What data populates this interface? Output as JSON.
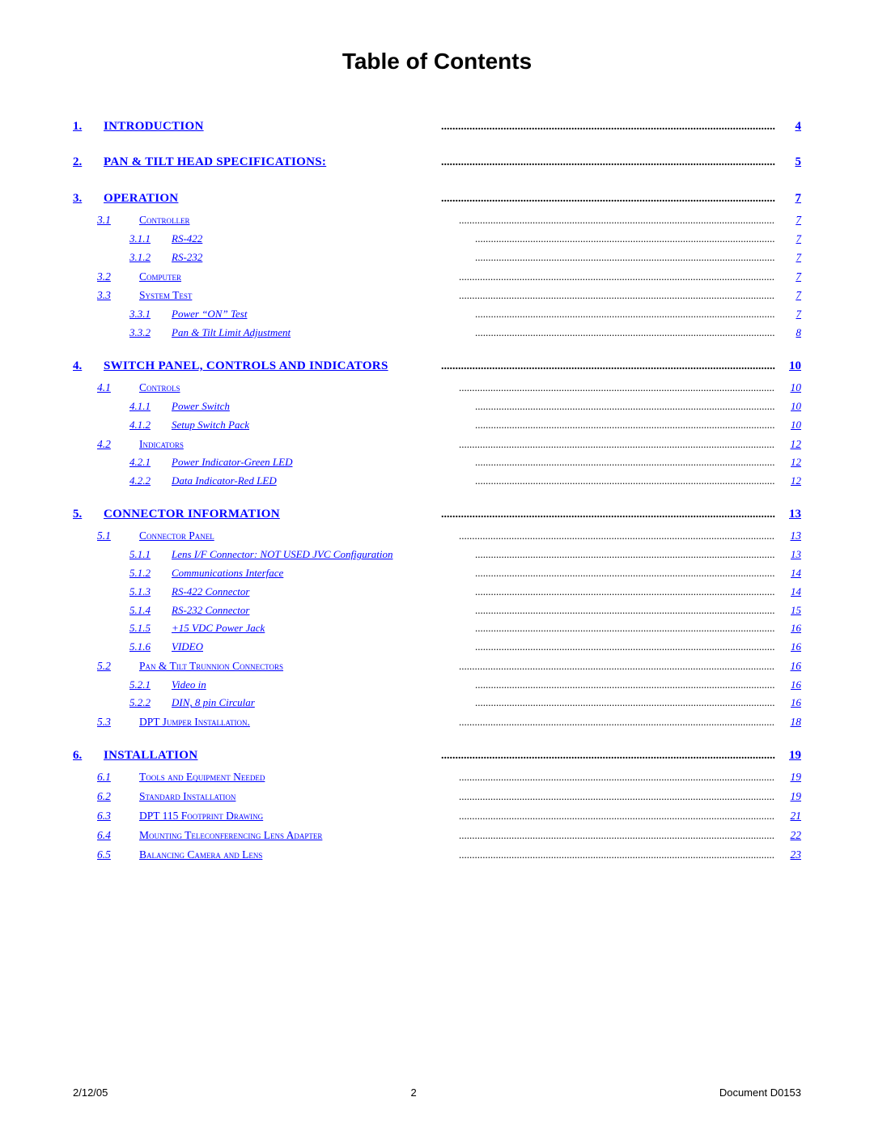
{
  "title": "Table of Contents",
  "sections": [
    {
      "num": "1.",
      "label": "INTRODUCTION",
      "page": "4",
      "level": "main",
      "children": []
    },
    {
      "num": "2.",
      "label": "PAN & TILT HEAD SPECIFICATIONS:",
      "page": "5",
      "level": "main",
      "children": []
    },
    {
      "num": "3.",
      "label": "OPERATION",
      "page": "7",
      "level": "main",
      "children": [
        {
          "num": "3.1",
          "label": "Controller",
          "page": "7",
          "level": "sub1",
          "children": [
            {
              "num": "3.1.1",
              "label": "RS-422",
              "page": "7",
              "level": "sub2"
            },
            {
              "num": "3.1.2",
              "label": "RS-232",
              "page": "7",
              "level": "sub2"
            }
          ]
        },
        {
          "num": "3.2",
          "label": "Computer",
          "page": "7",
          "level": "sub1",
          "children": []
        },
        {
          "num": "3.3",
          "label": "System Test",
          "page": "7",
          "level": "sub1",
          "children": [
            {
              "num": "3.3.1",
              "label": "Power “ON” Test",
              "page": "7",
              "level": "sub2"
            },
            {
              "num": "3.3.2",
              "label": "Pan & Tilt Limit Adjustment",
              "page": "8",
              "level": "sub2"
            }
          ]
        }
      ]
    },
    {
      "num": "4.",
      "label": "SWITCH PANEL, CONTROLS AND INDICATORS",
      "page": "10",
      "level": "main",
      "children": [
        {
          "num": "4.1",
          "label": "Controls",
          "page": "10",
          "level": "sub1",
          "children": [
            {
              "num": "4.1.1",
              "label": "Power Switch",
              "page": "10",
              "level": "sub2"
            },
            {
              "num": "4.1.2",
              "label": "Setup Switch Pack",
              "page": "10",
              "level": "sub2"
            }
          ]
        },
        {
          "num": "4.2",
          "label": "Indicators",
          "page": "12",
          "level": "sub1",
          "children": [
            {
              "num": "4.2.1",
              "label": "Power Indicator-Green LED",
              "page": "12",
              "level": "sub2"
            },
            {
              "num": "4.2.2",
              "label": "Data Indicator-Red LED",
              "page": "12",
              "level": "sub2"
            }
          ]
        }
      ]
    },
    {
      "num": "5.",
      "label": "CONNECTOR INFORMATION",
      "page": "13",
      "level": "main",
      "children": [
        {
          "num": "5.1",
          "label": "Connector Panel",
          "page": "13",
          "level": "sub1",
          "children": [
            {
              "num": "5.1.1",
              "label": "Lens I/F Connector: NOT USED JVC Configuration",
              "page": "13",
              "level": "sub2"
            },
            {
              "num": "5.1.2",
              "label": "Communications Interface",
              "page": "14",
              "level": "sub2"
            },
            {
              "num": "5.1.3",
              "label": "RS-422 Connector",
              "page": "14",
              "level": "sub2"
            },
            {
              "num": "5.1.4",
              "label": "RS-232 Connector",
              "page": "15",
              "level": "sub2"
            },
            {
              "num": "5.1.5",
              "label": "+15 VDC Power Jack",
              "page": "16",
              "level": "sub2"
            },
            {
              "num": "5.1.6",
              "label": "VIDEO",
              "page": "16",
              "level": "sub2"
            }
          ]
        },
        {
          "num": "5.2",
          "label": "Pan & Tilt Trunnion Connectors",
          "page": "16",
          "level": "sub1",
          "children": [
            {
              "num": "5.2.1",
              "label": "Video in",
              "page": "16",
              "level": "sub2"
            },
            {
              "num": "5.2.2",
              "label": "DIN, 8 pin Circular",
              "page": "16",
              "level": "sub2"
            }
          ]
        },
        {
          "num": "5.3",
          "label": "DPT Jumper Installation.",
          "page": "18",
          "level": "sub1",
          "children": []
        }
      ]
    },
    {
      "num": "6.",
      "label": "INSTALLATION",
      "page": "19",
      "level": "main",
      "children": [
        {
          "num": "6.1",
          "label": "Tools and Equipment Needed",
          "page": "19",
          "level": "sub1",
          "children": []
        },
        {
          "num": "6.2",
          "label": "Standard Installation",
          "page": "19",
          "level": "sub1",
          "children": []
        },
        {
          "num": "6.3",
          "label": "DPT 115 Footprint Drawing",
          "page": "21",
          "level": "sub1",
          "children": []
        },
        {
          "num": "6.4",
          "label": "Mounting Teleconferencing Lens Adapter",
          "page": "22",
          "level": "sub1",
          "children": []
        },
        {
          "num": "6.5",
          "label": "Balancing Camera and Lens",
          "page": "23",
          "level": "sub1",
          "children": []
        }
      ]
    }
  ],
  "footer": {
    "left": "2/12/05",
    "center": "2",
    "right": "Document D0153"
  }
}
